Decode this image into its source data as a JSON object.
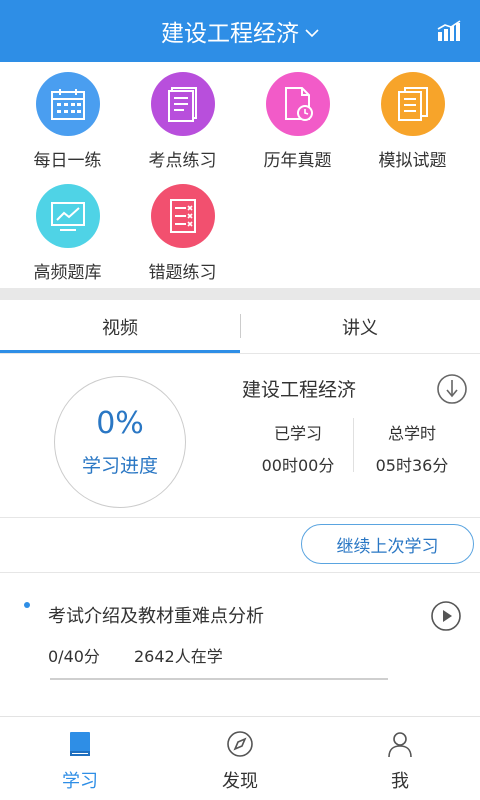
{
  "header": {
    "title": "建设工程经济",
    "dropdown_icon": "chevron-down-icon",
    "stats_icon": "bar-chart-icon"
  },
  "categories": [
    {
      "label": "每日一练",
      "icon": "calendar-icon",
      "color": "#4a9ef0"
    },
    {
      "label": "考点练习",
      "icon": "notebook-icon",
      "color": "#b84fdc"
    },
    {
      "label": "历年真题",
      "icon": "document-clock-icon",
      "color": "#f25bc8"
    },
    {
      "label": "模拟试题",
      "icon": "documents-icon",
      "color": "#f7a42a"
    },
    {
      "label": "高频题库",
      "icon": "trend-chart-icon",
      "color": "#4fd3e6"
    },
    {
      "label": "错题练习",
      "icon": "wrong-list-icon",
      "color": "#f2506f"
    }
  ],
  "tabs": [
    {
      "label": "视频",
      "active": true
    },
    {
      "label": "讲义",
      "active": false
    }
  ],
  "progress": {
    "percent_text": "0%",
    "label": "学习进度",
    "course_title": "建设工程经济",
    "studied_label": "已学习",
    "studied_value": "00时00分",
    "total_label": "总学时",
    "total_value": "05时36分"
  },
  "continue_button": "继续上次学习",
  "lesson": {
    "title": "考试介绍及教材重难点分析",
    "score": "0/40分",
    "learners": "2642人在学",
    "progress": 0
  },
  "bottom_nav": [
    {
      "label": "学习",
      "icon": "book-icon",
      "active": true
    },
    {
      "label": "发现",
      "icon": "compass-icon",
      "active": false
    },
    {
      "label": "我",
      "icon": "user-icon",
      "active": false
    }
  ],
  "colors": {
    "primary": "#2e8ee6",
    "active_text": "#2a77c4",
    "nav_active": "#2e8ee6",
    "nav_inactive": "#333333"
  }
}
